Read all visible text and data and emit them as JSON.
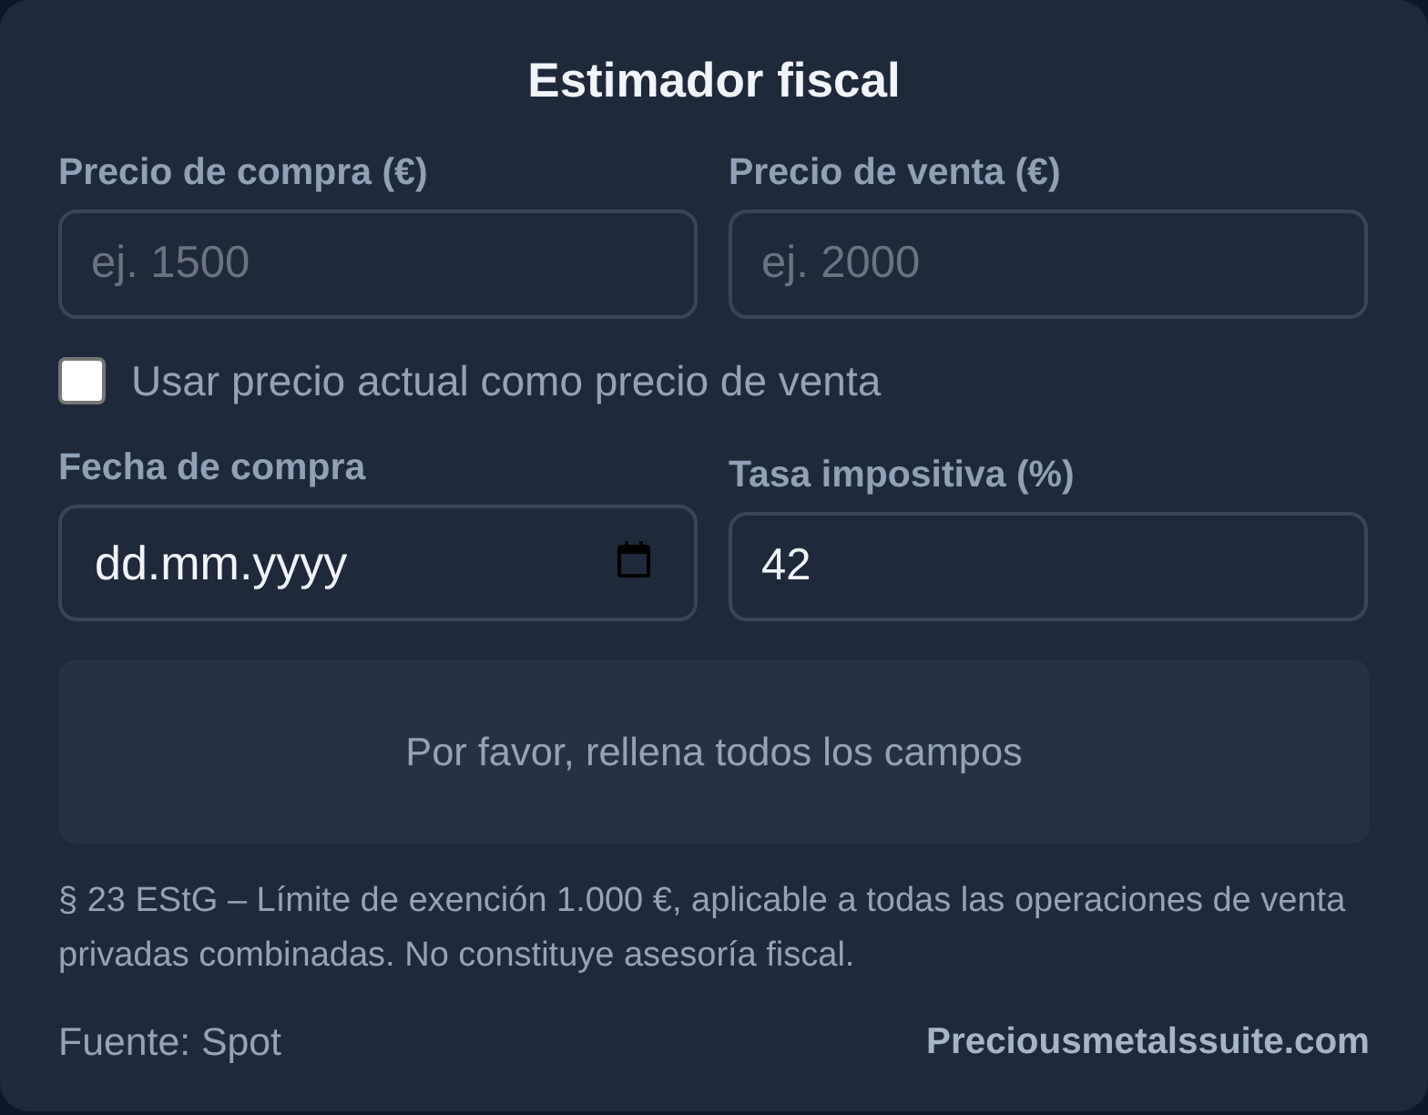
{
  "title": "Estimador fiscal",
  "top_fields": [
    {
      "kind": "number",
      "label": "Precio de compra (€)",
      "placeholder": "ej. 1500"
    },
    {
      "kind": "number",
      "label": "Precio de venta (€)",
      "placeholder": "ej. 2000"
    }
  ],
  "use_current_price": {
    "label": "Usar precio actual como precio de venta",
    "checked": false
  },
  "bottom_fields": [
    {
      "kind": "date",
      "label": "Fecha de compra",
      "placeholder": "dd.mm.yyyy"
    },
    {
      "kind": "number",
      "label": "Tasa impositiva (%)",
      "value": "42"
    }
  ],
  "message": "Por favor, rellena todos los campos",
  "note": "§ 23 EStG – Límite de exención 1.000 €, aplicable a todas las operaciones de venta privadas combinadas. No constituye asesoría fiscal.",
  "footer": {
    "source": "Fuente: Spot",
    "brand": "Preciousmetalssuite.com"
  }
}
